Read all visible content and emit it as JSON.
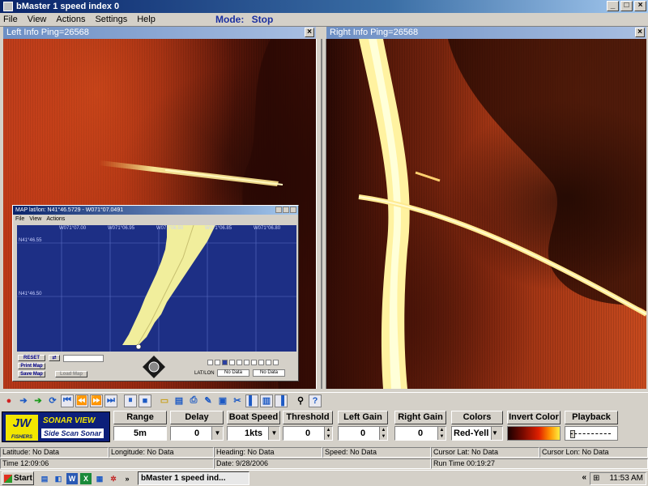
{
  "window": {
    "title": "bMaster 1 speed index 0"
  },
  "menu": [
    "File",
    "View",
    "Actions",
    "Settings",
    "Help"
  ],
  "mode": {
    "label": "Mode:",
    "value": "Stop"
  },
  "left_panel": {
    "title": "Left Info  Ping=26568"
  },
  "right_panel": {
    "title": "Right Info  Ping=26568"
  },
  "map_window": {
    "title": "MAP lat/lon: N41°46.5729 - W071°07.0491",
    "menu": [
      "File",
      "View",
      "Actions"
    ],
    "lon_labels": [
      "W071°07.00",
      "W071°06.95",
      "W071°06.90",
      "W071°06.85",
      "W071°06.80"
    ],
    "lat_labels": [
      "N41°46.55",
      "N41°46.50"
    ],
    "buttons": {
      "reset": "RESET",
      "print": "Print Map",
      "save": "Save Map",
      "load": "Load Map"
    },
    "latlon_label": "LAT/LON",
    "lat_value": "No Data",
    "lon_value": "No Data"
  },
  "controls": {
    "logo": {
      "brand": "JW",
      "brand_sub": "FISHERS",
      "product": "SONAR VIEW",
      "tagline": "Side Scan Sonar"
    },
    "range": {
      "label": "Range",
      "value": "5m"
    },
    "delay": {
      "label": "Delay",
      "value": "0"
    },
    "boat_speed": {
      "label": "Boat Speed",
      "value": "1kts"
    },
    "threshold": {
      "label": "Threshold",
      "value": "0"
    },
    "left_gain": {
      "label": "Left Gain",
      "value": "0"
    },
    "right_gain": {
      "label": "Right Gain",
      "value": "0"
    },
    "colors": {
      "label": "Colors",
      "value": "Red-Yell"
    },
    "invert_color": {
      "label": "Invert Color"
    },
    "playback": {
      "label": "Playback"
    }
  },
  "status_row1": {
    "latitude": "Latitude: No Data",
    "longitude": "Longitude: No Data",
    "heading": "Heading: No Data",
    "speed": "Speed: No Data",
    "cursor_lat": "Cursor Lat: No Data",
    "cursor_lon": "Cursor Lon: No Data"
  },
  "status_row2": {
    "time": "Time 12:09:06",
    "date": "Date: 9/28/2006",
    "run_time": "Run Time 00:19:27"
  },
  "taskbar": {
    "start": "Start",
    "task": "bMaster 1 speed ind...",
    "clock": "11:53 AM"
  },
  "colors": {
    "accent": "#1a2fa0",
    "map_bg": "#1d2f85",
    "track": "#f1ee9c"
  }
}
